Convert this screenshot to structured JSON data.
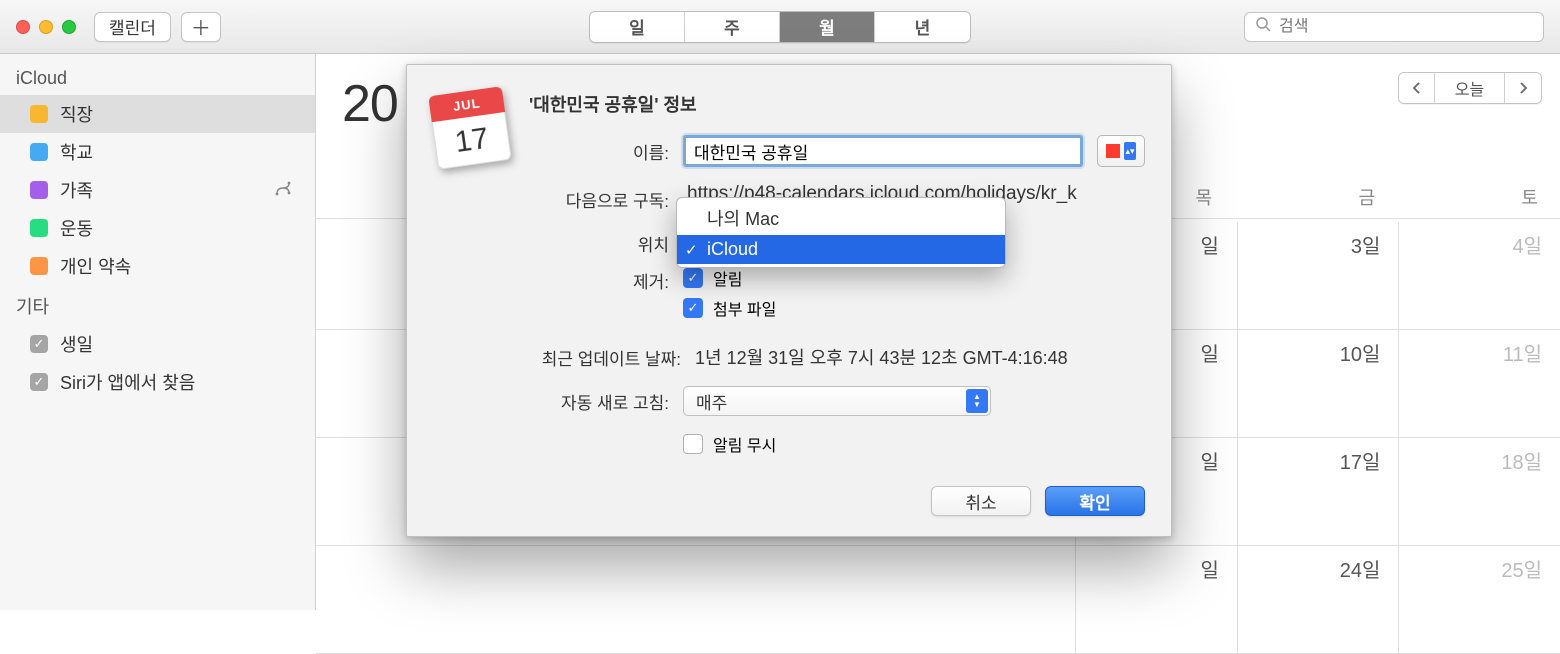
{
  "titlebar": {
    "app_button": "캘린더",
    "plus": "＋",
    "views": {
      "day": "일",
      "week": "주",
      "month": "월",
      "year": "년",
      "active": "month"
    },
    "search_placeholder": "검색"
  },
  "sidebar": {
    "section1": "iCloud",
    "items1": [
      {
        "label": "직장",
        "color": "#f7b731",
        "selected": true,
        "share": false
      },
      {
        "label": "학교",
        "color": "#45aaf2",
        "selected": false,
        "share": false
      },
      {
        "label": "가족",
        "color": "#a55eea",
        "selected": false,
        "share": true
      },
      {
        "label": "운동",
        "color": "#26de81",
        "selected": false,
        "share": false
      },
      {
        "label": "개인 약속",
        "color": "#fd9644",
        "selected": false,
        "share": false
      }
    ],
    "section2": "기타",
    "items2": [
      {
        "label": "생일"
      },
      {
        "label": "Siri가 앱에서 찾음"
      }
    ]
  },
  "content": {
    "year_fragment": "20",
    "dow_thu": "목",
    "dow_fri": "금",
    "dow_sat": "토",
    "today_btn": "오늘",
    "cells": {
      "r1_thu": "일",
      "r1_fri": "3일",
      "r1_sat": "4일",
      "r2_thu": "일",
      "r2_fri": "10일",
      "r2_sat": "11일",
      "r3_thu": "일",
      "r3_fri": "17일",
      "r3_sat": "18일",
      "r4_thu": "일",
      "r4_fri": "24일",
      "r4_sat": "25일"
    }
  },
  "dialog": {
    "icon_month": "JUL",
    "icon_day": "17",
    "title": "'대한민국 공휴일' 정보",
    "name_label": "이름:",
    "name_value": "대한민국 공휴일",
    "sub_label": "다음으로 구독:",
    "sub_value": "https://p48-calendars.icloud.com/holidays/kr_k",
    "loc_label": "위치",
    "remove_label": "제거:",
    "chk_alert": "알림",
    "chk_attach": "첨부 파일",
    "upd_label": "최근 업데이트 날짜:",
    "upd_value": "1년 12월 31일 오후 7시 43분 12초 GMT-4:16:48",
    "refresh_label": "자동 새로 고침:",
    "refresh_value": "매주",
    "ignore_label": "알림 무시",
    "cancel": "취소",
    "ok": "확인"
  },
  "popup": {
    "opt_mac": "나의 Mac",
    "opt_icloud": "iCloud"
  }
}
